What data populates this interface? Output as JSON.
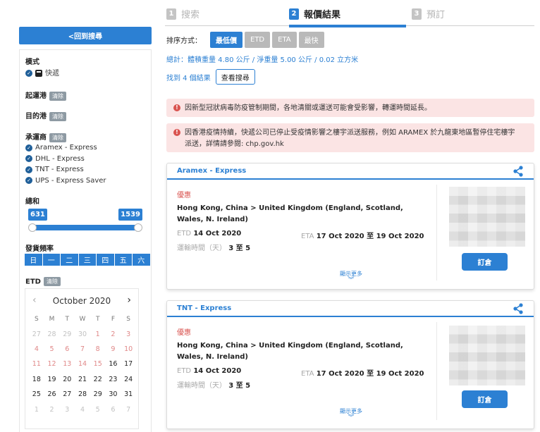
{
  "steps": [
    {
      "num": "1",
      "label": "搜索"
    },
    {
      "num": "2",
      "label": "報價結果"
    },
    {
      "num": "3",
      "label": "預訂"
    }
  ],
  "sidebar": {
    "back_label": "<回到搜尋",
    "mode_label": "模式",
    "mode_value": "快遞",
    "origin_label": "起運港",
    "dest_label": "目的港",
    "carrier_label": "承運商",
    "clear_label": "清除",
    "carriers": [
      "Aramex - Express",
      "DHL - Express",
      "TNT - Express",
      "UPS - Express Saver"
    ],
    "total_label": "總和",
    "range_min": "631",
    "range_max": "1539",
    "freq_label": "發貨頻率",
    "freq_days": [
      "日",
      "一",
      "二",
      "三",
      "四",
      "五",
      "六"
    ],
    "etd_label": "ETD"
  },
  "calendar": {
    "title": "October 2020",
    "prev": "‹",
    "next": "›",
    "dow": [
      "S",
      "M",
      "T",
      "W",
      "T",
      "F",
      "S"
    ],
    "rows": [
      [
        "27",
        "28",
        "29",
        "30",
        "1",
        "2",
        "3"
      ],
      [
        "4",
        "5",
        "6",
        "7",
        "8",
        "9",
        "10"
      ],
      [
        "11",
        "12",
        "13",
        "14",
        "15",
        "16",
        "17"
      ],
      [
        "18",
        "19",
        "20",
        "21",
        "22",
        "23",
        "24"
      ],
      [
        "25",
        "26",
        "27",
        "28",
        "29",
        "30",
        "31"
      ],
      [
        "1",
        "2",
        "3",
        "4",
        "5",
        "6",
        "7"
      ]
    ]
  },
  "main": {
    "sort_label": "排序方式：",
    "sort_options": [
      "最低價",
      "ETD",
      "ETA",
      "最快"
    ],
    "totals": "總計：體積重量 4.80 公斤 / 淨重量 5.00 公斤 / 0.02 立方米",
    "found": "找到 4 個結果",
    "view_search": "查看搜尋",
    "alerts": [
      "因新型冠狀病毒防疫管制期間，各地清關或運送可能會受影響，轉運時間延長。",
      "因香港疫情持續，快遞公司已停止受疫情影響之樓宇派送服務，例如 ARAMEX 於九龍東地區暫停住宅樓宇派送，詳情請參閱: chp.gov.hk"
    ]
  },
  "results": [
    {
      "title": "Aramex - Express",
      "offer": "優惠",
      "route": "Hong Kong, China > United Kingdom (England, Scotland, Wales, N. Ireland)",
      "etd_key": "ETD",
      "etd_val": "14 Oct 2020",
      "eta_key": "ETA",
      "eta_val": "17 Oct 2020 至 19 Oct 2020",
      "transit_key": "運輸時間（天）",
      "transit_val": "3 至 5",
      "more": "顯示更多",
      "order": "訂倉"
    },
    {
      "title": "TNT - Express",
      "offer": "優惠",
      "route": "Hong Kong, China > United Kingdom (England, Scotland, Wales, N. Ireland)",
      "etd_key": "ETD",
      "etd_val": "14 Oct 2020",
      "eta_key": "ETA",
      "eta_val": "17 Oct 2020 至 19 Oct 2020",
      "transit_key": "運輸時間（天）",
      "transit_val": "3 至 5",
      "more": "顯示更多",
      "order": "訂倉"
    }
  ],
  "colors": {
    "accent": "#2c80d3",
    "alert_bg": "#fbe4e4",
    "alert_icon": "#d9534f"
  }
}
